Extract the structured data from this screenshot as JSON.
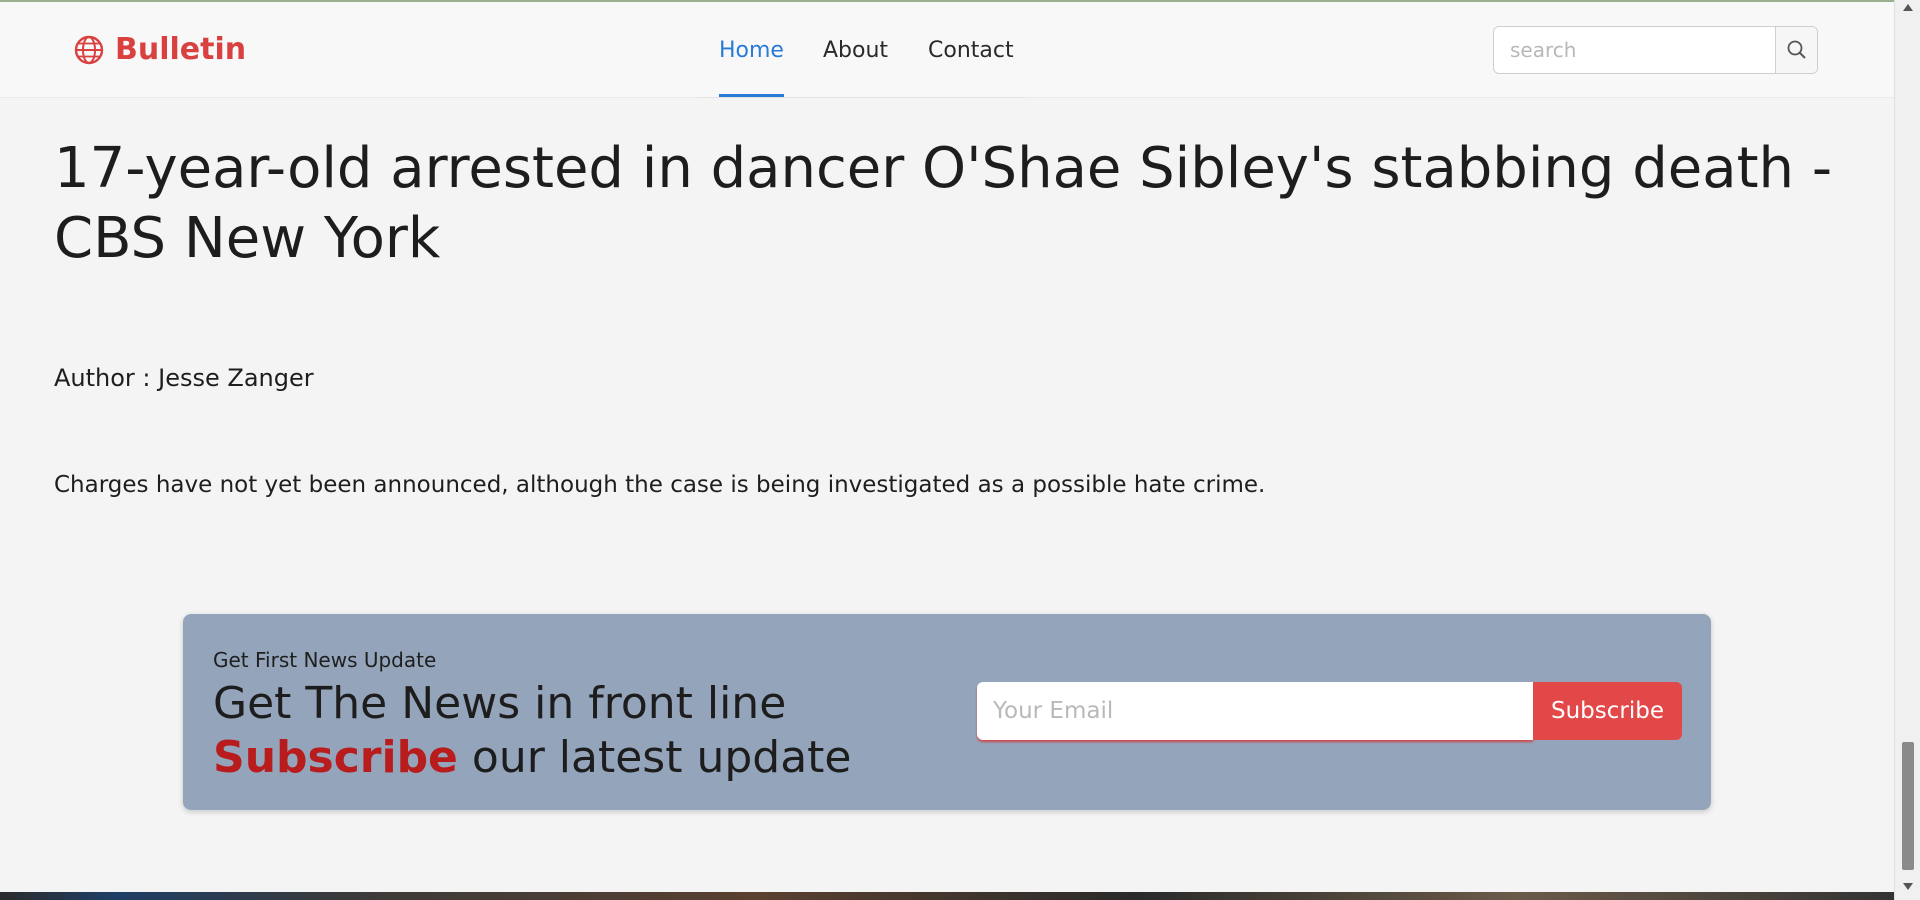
{
  "brand": {
    "name": "Bulletin",
    "color": "#d94040"
  },
  "nav": {
    "items": [
      {
        "label": "Home",
        "active": true
      },
      {
        "label": "About",
        "active": false
      },
      {
        "label": "Contact",
        "active": false
      }
    ],
    "accent": "#2a7bd6"
  },
  "search": {
    "placeholder": "search"
  },
  "article": {
    "title": "17-year-old arrested in dancer O'Shae Sibley's stabbing death - CBS New York",
    "author": "Author : Jesse Zanger",
    "summary": "Charges have not yet been announced, although the case is being investigated as a possible hate crime."
  },
  "subscribe": {
    "kicker": "Get First News Update",
    "headline": "Get The News in front line",
    "accent_word": "Subscribe",
    "tail": " our latest update",
    "email_placeholder": "Your Email",
    "button_label": "Subscribe",
    "button_color": "#e34848"
  }
}
